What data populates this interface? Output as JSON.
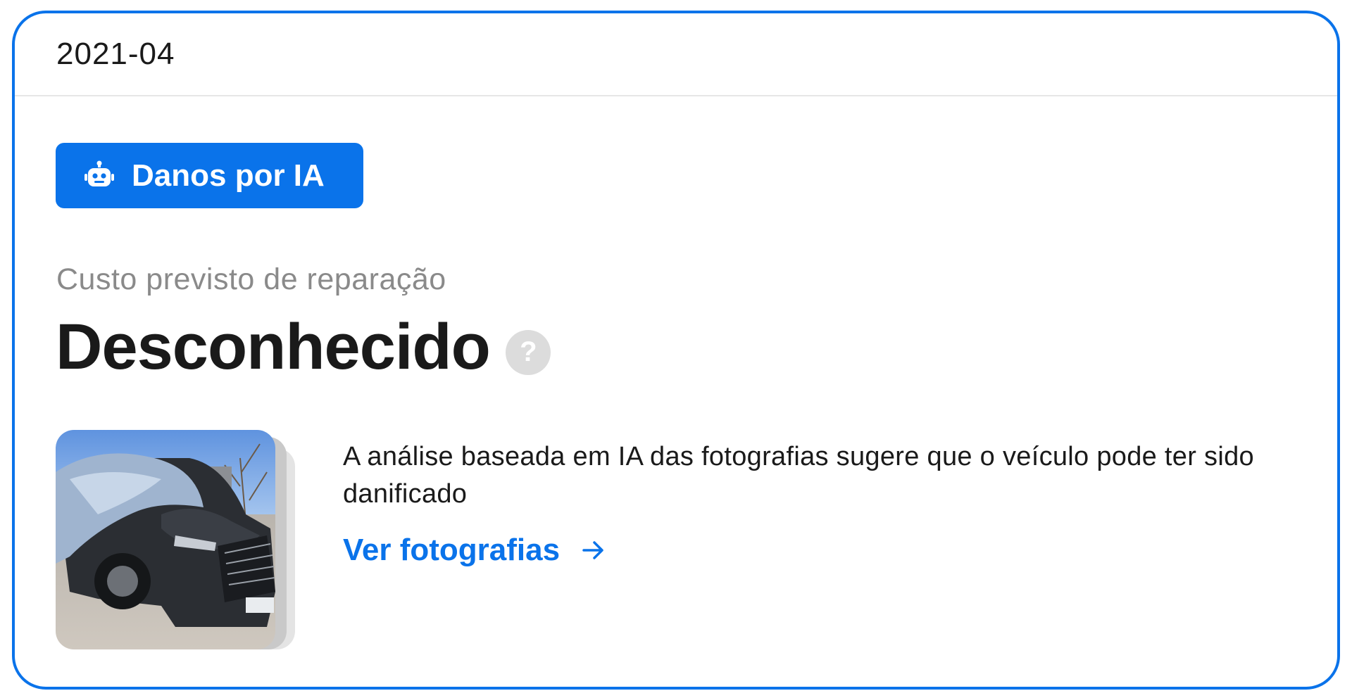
{
  "card": {
    "period": "2021-04",
    "ai_badge": {
      "label": "Danos por IA",
      "icon": "robot-icon"
    },
    "cost_label": "Custo previsto de reparação",
    "cost_value": "Desconhecido",
    "help_icon": "question-icon",
    "help_glyph": "?",
    "description": "A análise baseada em IA das fotografias sugere que o veículo pode ter sido danificado",
    "link_label": "Ver fotografias",
    "link_icon": "arrow-right-icon"
  },
  "colors": {
    "accent": "#0a73ea",
    "muted_text": "#8a8a8a",
    "divider": "#e6e6e6",
    "help_icon_bg": "#dcdcdc"
  }
}
